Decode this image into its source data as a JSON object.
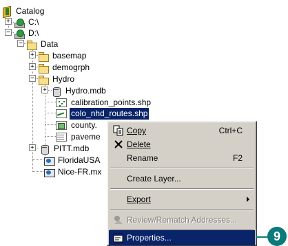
{
  "tree": {
    "items": [
      {
        "label": "Catalog",
        "icon": "catalog-icon"
      },
      {
        "label": "C:\\",
        "icon": "drive-icon"
      },
      {
        "label": "D:\\",
        "icon": "drive-icon"
      },
      {
        "label": "Data",
        "icon": "folder-open-icon"
      },
      {
        "label": "basemap",
        "icon": "folder-icon"
      },
      {
        "label": "demogrph",
        "icon": "folder-icon"
      },
      {
        "label": "Hydro",
        "icon": "folder-open-icon"
      },
      {
        "label": "Hydro.mdb",
        "icon": "geodatabase-icon"
      },
      {
        "label": "calibration_points.shp",
        "icon": "point-shapefile-icon"
      },
      {
        "label": "colo_nhd_routes.shp",
        "icon": "line-shapefile-icon"
      },
      {
        "label": "county.",
        "icon": "polygon-shapefile-icon"
      },
      {
        "label": "paveme",
        "icon": "table-icon"
      },
      {
        "label": "PITT.mdb",
        "icon": "geodatabase-icon"
      },
      {
        "label": "FloridaUSA",
        "icon": "map-document-icon"
      },
      {
        "label": "Nice-FR.mx",
        "icon": "map-document-icon"
      }
    ]
  },
  "context_menu": {
    "copy": {
      "label": "Copy",
      "shortcut": "Ctrl+C"
    },
    "delete": {
      "label": "Delete"
    },
    "rename": {
      "label": "Rename",
      "shortcut": "F2"
    },
    "create_layer": {
      "label": "Create Layer..."
    },
    "export": {
      "label": "Export"
    },
    "review_rematch": {
      "label": "Review/Rematch Addresses..."
    },
    "properties": {
      "label": "Properties..."
    }
  },
  "callout": {
    "number": "9"
  }
}
